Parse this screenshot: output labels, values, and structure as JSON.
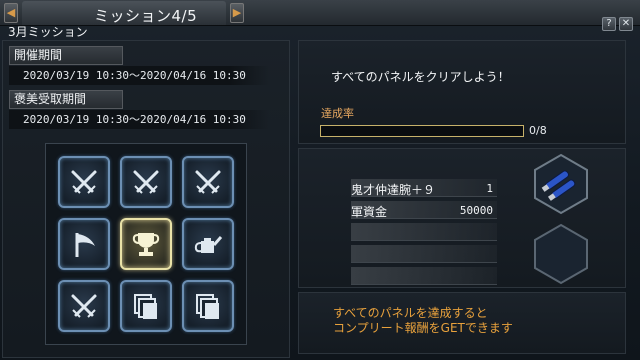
{
  "window": {
    "title": "ミッション4/5",
    "subtitle": "3月ミッション",
    "help_label": "?",
    "close_label": "✕",
    "prev_arrow": "◀",
    "next_arrow": "▶"
  },
  "period": {
    "held_label": "開催期間",
    "held_dates": "2020/03/19 10:30～2020/04/16 10:30",
    "reward_label": "褒美受取期間",
    "reward_dates": "2020/03/19 10:30～2020/04/16 10:30"
  },
  "panels": [
    {
      "icon": "crossed-swords-icon",
      "selected": false
    },
    {
      "icon": "crossed-swords-icon",
      "selected": false
    },
    {
      "icon": "crossed-swords-icon",
      "selected": false
    },
    {
      "icon": "flag-icon",
      "selected": false
    },
    {
      "icon": "trophy-icon",
      "selected": true
    },
    {
      "icon": "watering-can-icon",
      "selected": false
    },
    {
      "icon": "crossed-swords-icon",
      "selected": false
    },
    {
      "icon": "cards-icon",
      "selected": false
    },
    {
      "icon": "cards-icon",
      "selected": false
    }
  ],
  "mission": {
    "description": "すべてのパネルをクリアしよう！",
    "rate_label": "達成率",
    "progress_text": "0/8",
    "progress_fraction": 0.0
  },
  "rewards": {
    "items": [
      {
        "name": "鬼才仲達腕＋９",
        "qty": "1"
      },
      {
        "name": "軍資金",
        "qty": "50000"
      },
      {
        "name": "",
        "qty": ""
      },
      {
        "name": "",
        "qty": ""
      },
      {
        "name": "",
        "qty": ""
      }
    ]
  },
  "note": {
    "line1": "すべてのパネルを達成すると",
    "line2": "コンプリート報酬をGETできます"
  },
  "colors": {
    "accent_orange": "#e8a13c",
    "tile_border": "#6c8fb3",
    "tile_selected": "#e9e2a8"
  }
}
